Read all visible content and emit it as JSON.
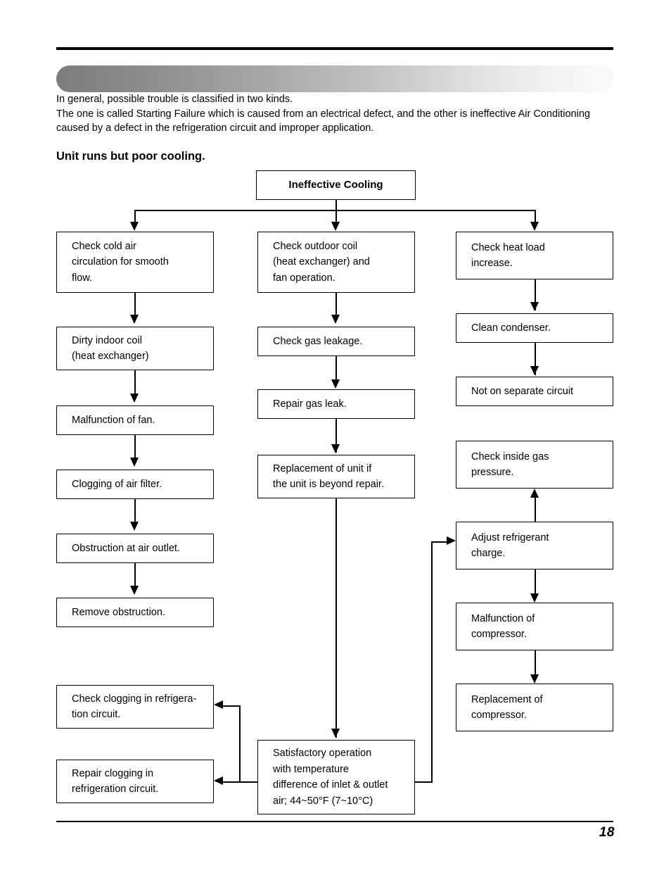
{
  "document": {
    "page_number": "18",
    "intro": {
      "line1": "In general, possible trouble is classified in two kinds.",
      "line2": "The one is called Starting Failure which is caused from an electrical defect, and the other is ineffective Air Conditioning caused by a defect in the refrigeration circuit and improper application."
    },
    "section_title": "Unit runs but poor cooling."
  },
  "flowchart": {
    "root": {
      "label": "Ineffective Cooling"
    },
    "left_column": [
      {
        "l1": "Check cold air",
        "l2": "circulation for smooth",
        "l3": "flow."
      },
      {
        "l1": "Dirty indoor coil",
        "l2": "(heat exchanger)"
      },
      {
        "l1": "Malfunction of fan."
      },
      {
        "l1": "Clogging of air filter."
      },
      {
        "l1": "Obstruction at air outlet."
      },
      {
        "l1": "Remove obstruction."
      }
    ],
    "left_bottom": [
      {
        "l1": "Check clogging in refrigera-",
        "l2": "tion circuit."
      },
      {
        "l1": "Repair clogging in",
        "l2": "refrigeration circuit."
      }
    ],
    "center_column": [
      {
        "l1": "Check outdoor coil",
        "l2": "(heat exchanger) and",
        "l3": "fan operation."
      },
      {
        "l1": "Check gas leakage."
      },
      {
        "l1": "Repair gas leak."
      },
      {
        "l1": "Replacement of unit if",
        "l2": "the unit is beyond repair."
      }
    ],
    "center_bottom": {
      "l1": "Satisfactory operation",
      "l2": "with temperature",
      "l3": "difference of inlet & outlet",
      "l4": "air; 44~50°F (7~10°C)"
    },
    "right_column": [
      {
        "l1": "Check heat load",
        "l2": "increase."
      },
      {
        "l1": "Clean condenser."
      },
      {
        "l1": "Not on separate circuit"
      }
    ],
    "right_lower": [
      {
        "l1": "Check inside gas",
        "l2": "pressure."
      },
      {
        "l1": "Adjust refrigerant",
        "l2": "charge."
      },
      {
        "l1": "Malfunction of",
        "l2": "compressor."
      },
      {
        "l1": "Replacement of",
        "l2": "compressor."
      }
    ]
  }
}
